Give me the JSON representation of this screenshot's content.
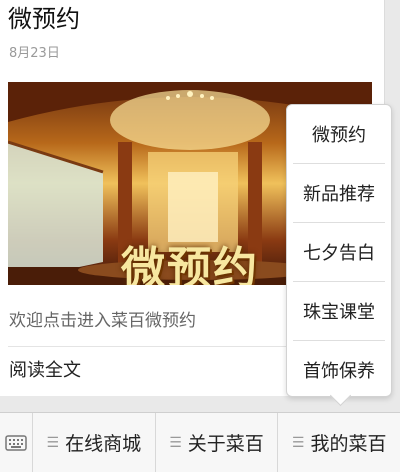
{
  "article": {
    "title": "微预约",
    "date": "8月23日",
    "banner_text": "微预约",
    "summary": "欢迎点击进入菜百微预约",
    "read_more": "阅读全文"
  },
  "popup_menu": {
    "items": [
      "微预约",
      "新品推荐",
      "七夕告白",
      "珠宝课堂",
      "首饰保养"
    ]
  },
  "bottom_menu": {
    "keyboard_icon": "keyboard-icon",
    "items": [
      {
        "label": "在线商城",
        "icon": "menu-lines-icon"
      },
      {
        "label": "关于菜百",
        "icon": "menu-lines-icon"
      },
      {
        "label": "我的菜百",
        "icon": "menu-lines-icon"
      }
    ]
  }
}
